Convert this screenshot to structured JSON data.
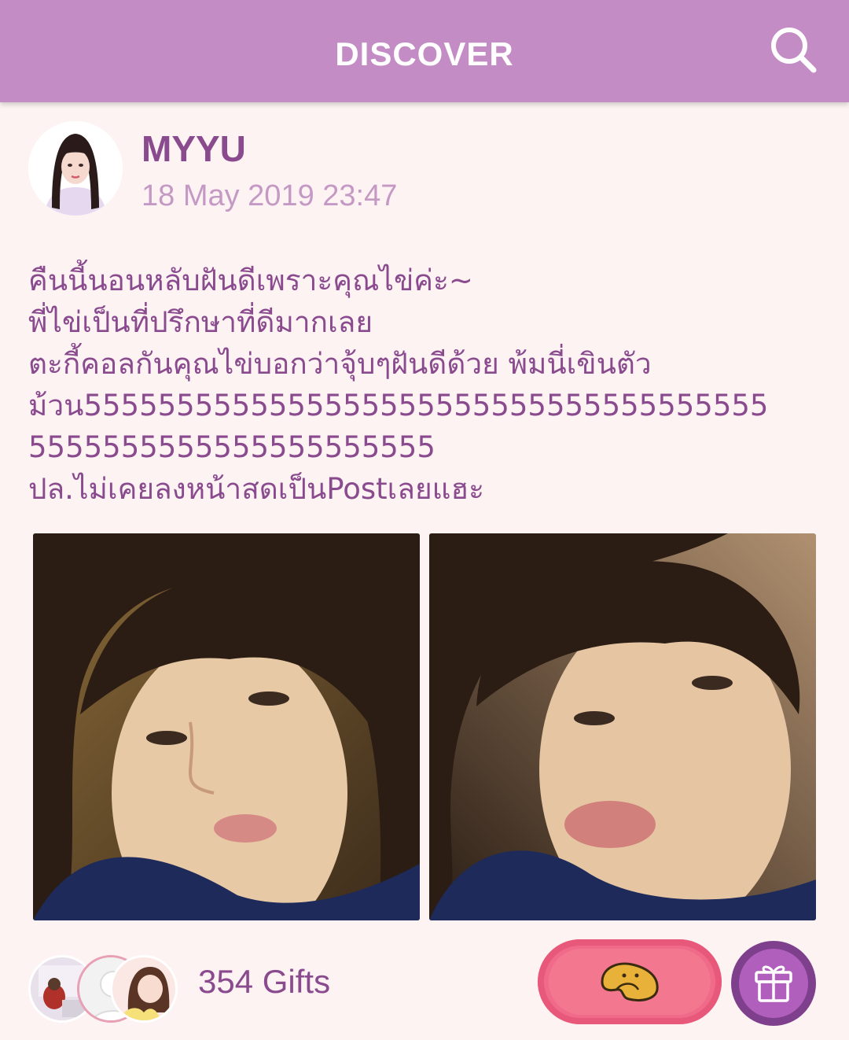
{
  "header": {
    "title": "DISCOVER",
    "search_icon": "search-icon"
  },
  "post": {
    "author": "MYYU",
    "timestamp": "18 May 2019 23:47",
    "text_lines": [
      "คืนนี้นอนหลับฝันดีเพราะคุณไข่ค่ะ~",
      "พี่ไข่เป็นที่ปรึกษาที่ดีมากเลย",
      "ตะกี้คอลกันคุณไข่บอกว่าจุ้บๆฝันดีด้วย พ้มนี่เขินตัว",
      "ม้วน5555555555555555555555555555555555555",
      "5555555555555555555555",
      "ปล.ไม่เคยลงหน้าสดเป็นPostเลยแฮะ"
    ],
    "photos": [
      {
        "alt": "photo-1"
      },
      {
        "alt": "photo-2"
      }
    ]
  },
  "footer": {
    "gift_count": "354 Gifts",
    "fortune_icon": "fortune-cookie-icon",
    "gift_icon": "gift-icon"
  },
  "colors": {
    "header_bg": "#c48cc4",
    "page_bg": "#fdf3f3",
    "text_primary": "#8a4a8e",
    "text_secondary": "#c49ac4",
    "fortune_button": "#f06a8a",
    "gift_button": "#b15fbd"
  }
}
